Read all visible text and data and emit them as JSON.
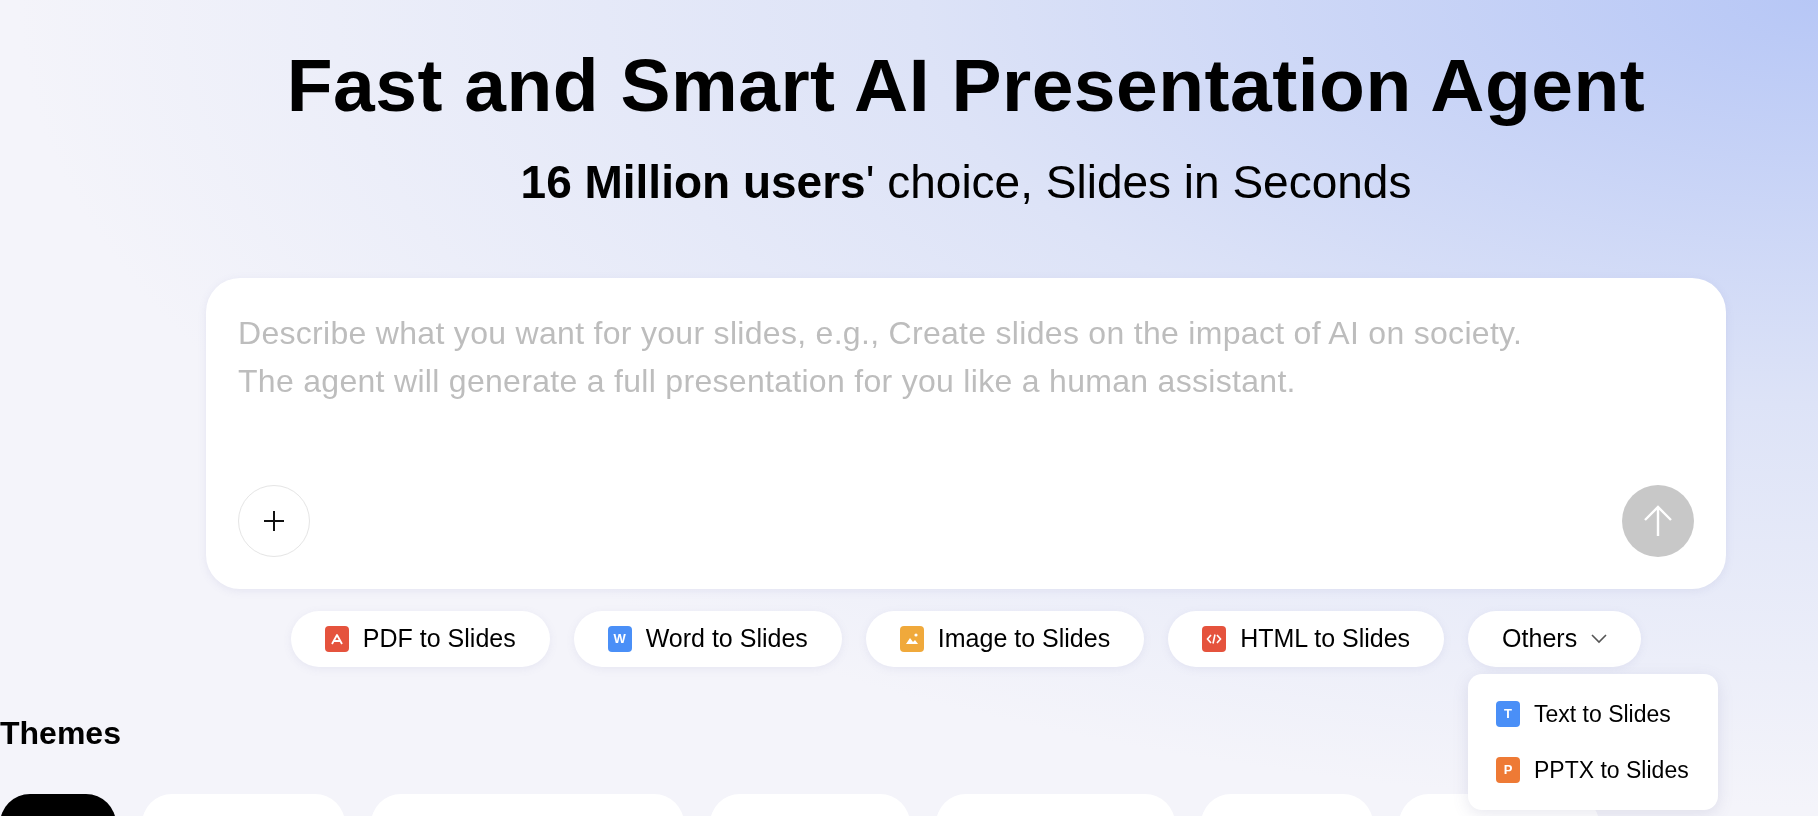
{
  "header": {
    "title": "Fast and Smart AI Presentation Agent",
    "subtitle": "**16 Million users**' choice, Slides in Seconds"
  },
  "prompt": {
    "placeholder": "Describe what you want for your slides, e.g., Create slides on the impact of AI on society.\nThe agent will generate a full presentation for you like a human assistant.",
    "send_disabled": true
  },
  "shortcuts": [
    {
      "kind": "pdf",
      "label": "PDF to Slides"
    },
    {
      "kind": "word",
      "label": "Word to Slides",
      "icon_glyph": "W"
    },
    {
      "kind": "image",
      "label": "Image to Slides"
    },
    {
      "kind": "html",
      "label": "HTML to Slides"
    },
    {
      "kind": "more",
      "label": "Others",
      "expanded": true
    }
  ],
  "others_menu": [
    {
      "kind": "text",
      "label": "Text to Slides",
      "icon_glyph": "T"
    },
    {
      "kind": "pptx",
      "label": "PPTX to Slides",
      "icon_glyph": "P"
    }
  ],
  "themes": {
    "title": "Themes",
    "pills": [
      {
        "selected": true
      },
      {
        "selected": false
      },
      {
        "selected": false
      },
      {
        "selected": false
      },
      {
        "selected": false
      },
      {
        "selected": false
      },
      {
        "selected": false
      }
    ]
  }
}
